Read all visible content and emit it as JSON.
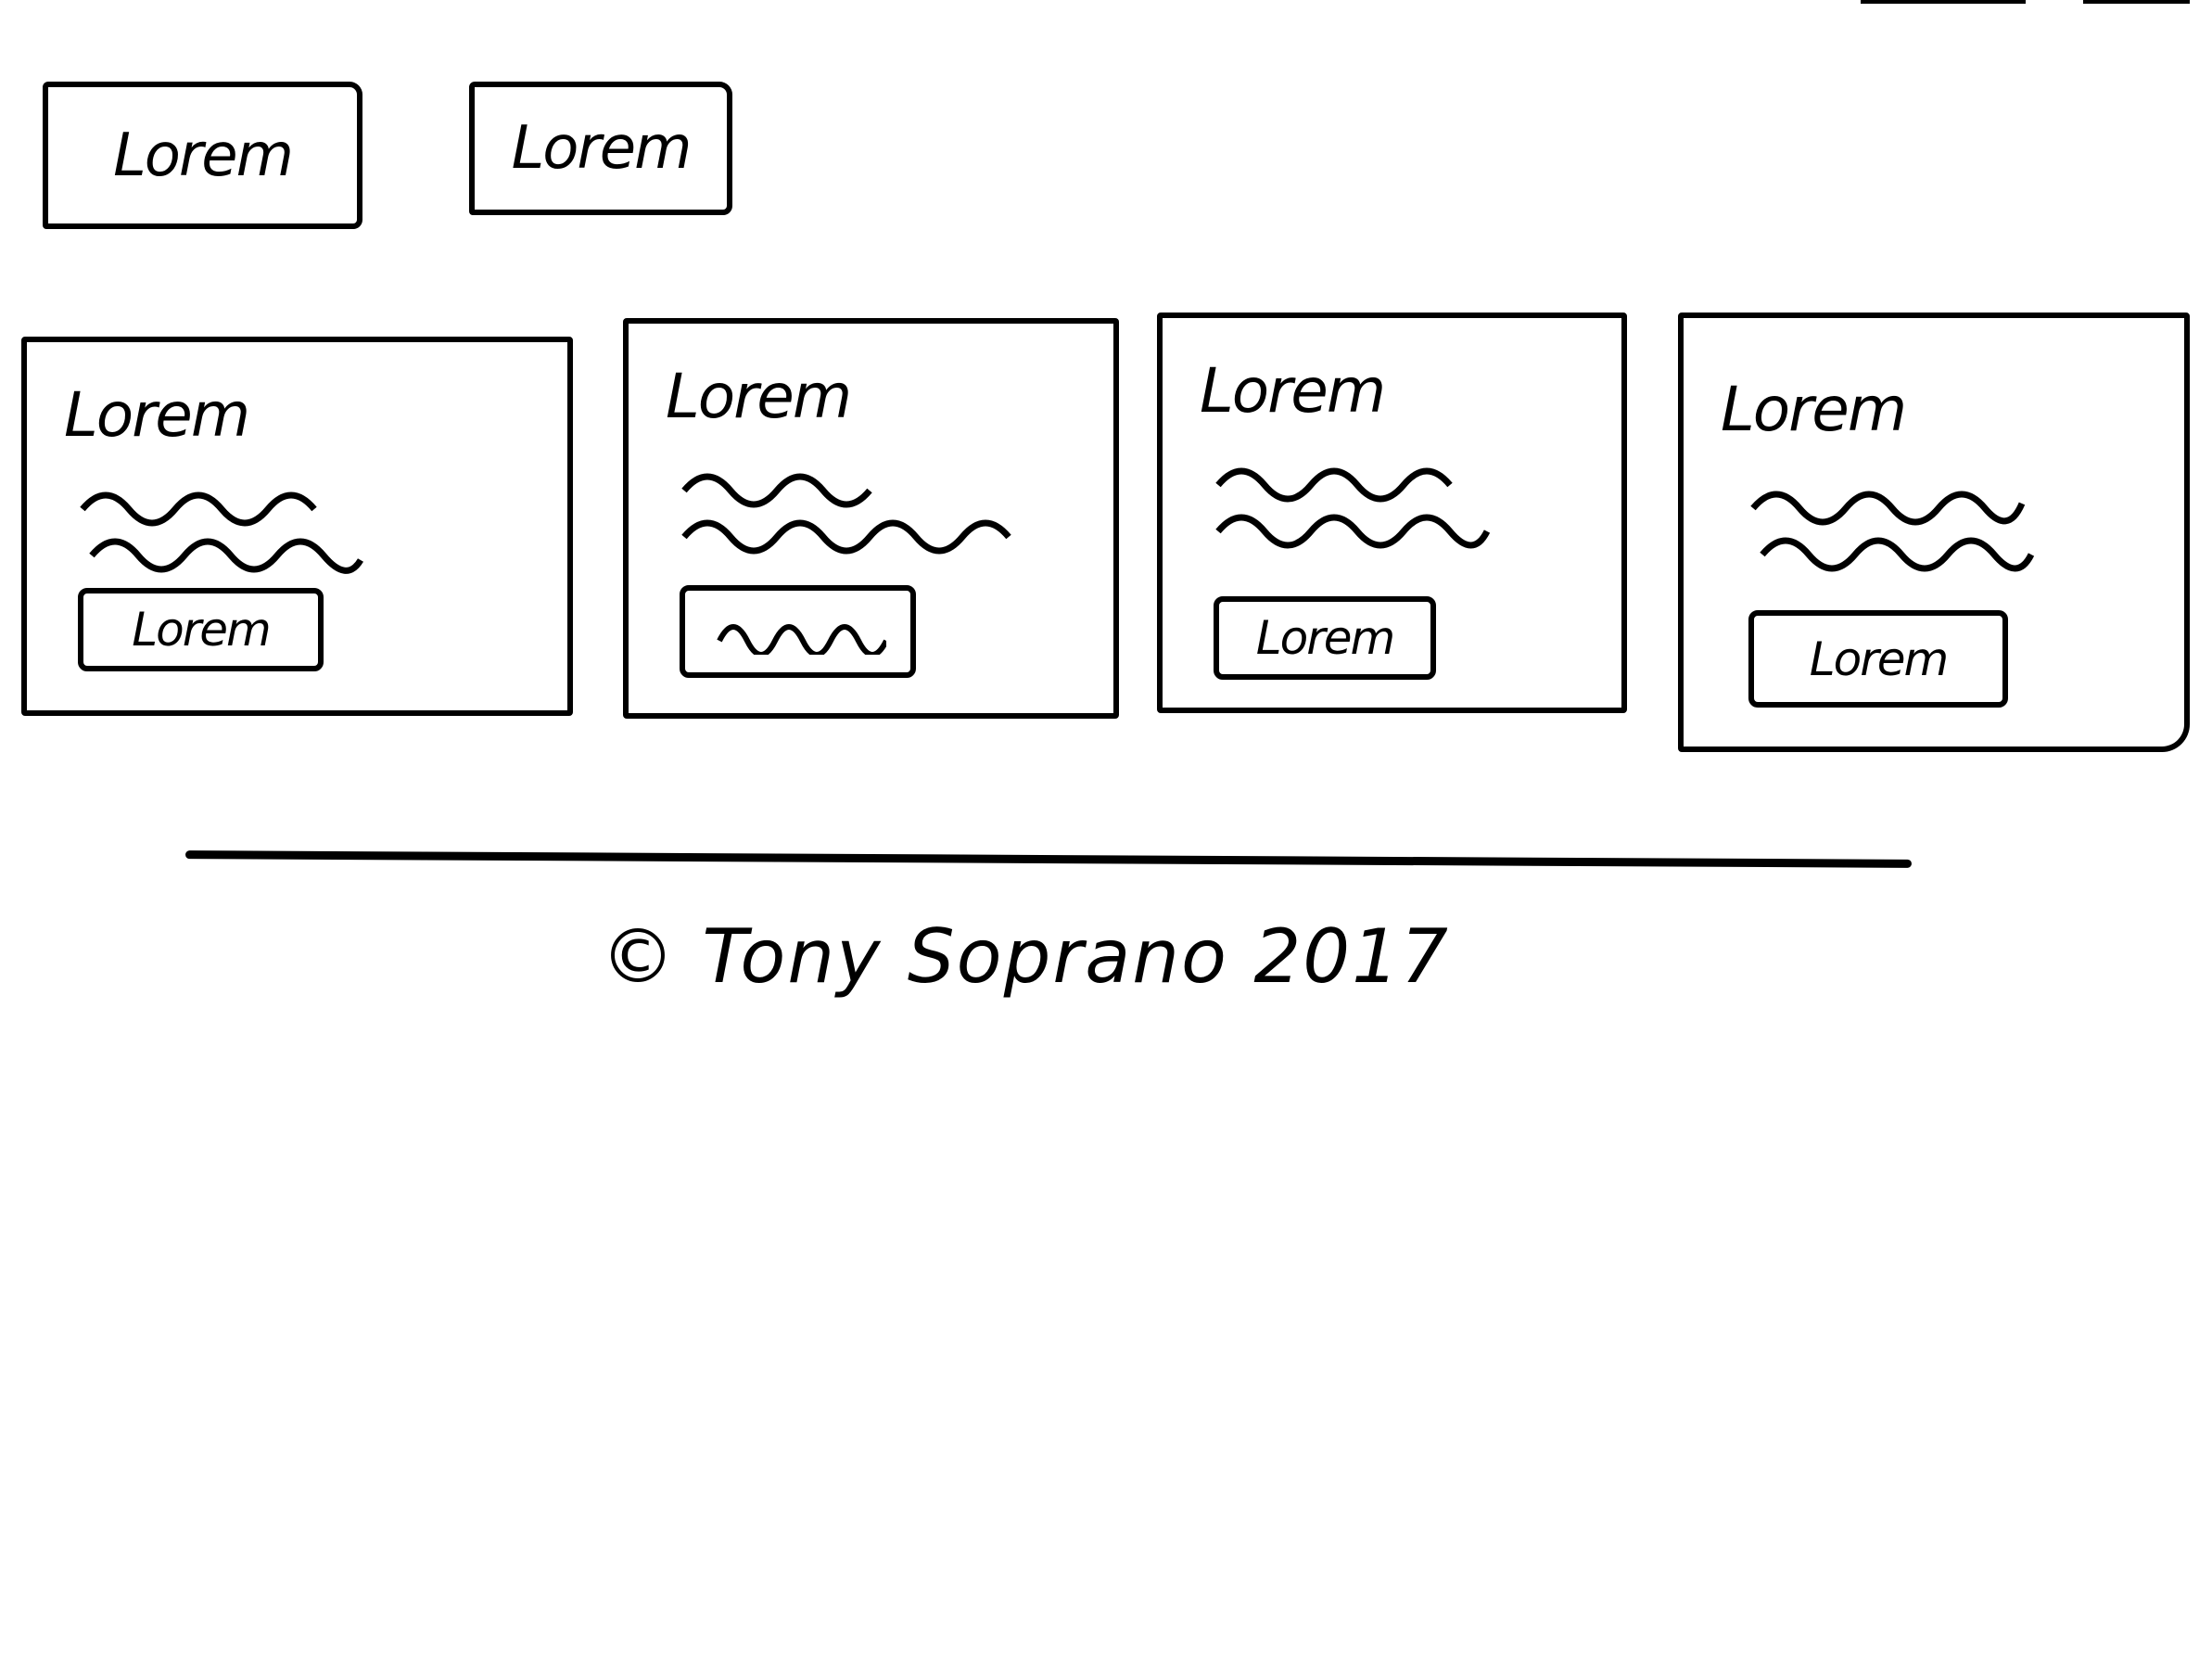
{
  "nav": {
    "buttons": [
      {
        "label": "Lorem"
      },
      {
        "label": "Lorem"
      }
    ]
  },
  "cards": [
    {
      "title": "Lorem",
      "button_label": "Lorem"
    },
    {
      "title": "Lorem",
      "button_label": ""
    },
    {
      "title": "Lorem",
      "button_label": "Lorem"
    },
    {
      "title": "Lorem",
      "button_label": "Lorem"
    }
  ],
  "footer": {
    "text": "© Tony Soprano 2017"
  }
}
